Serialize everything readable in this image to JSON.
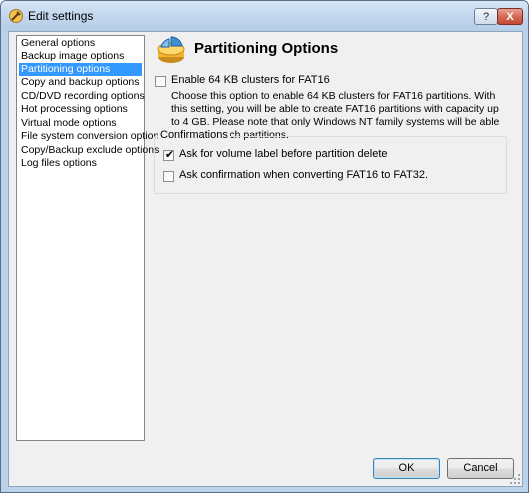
{
  "window": {
    "title": "Edit settings",
    "help_label": "?",
    "close_label": "X"
  },
  "nav": {
    "items": [
      {
        "label": "General options"
      },
      {
        "label": "Backup image options"
      },
      {
        "label": "Partitioning options"
      },
      {
        "label": "Copy and backup options"
      },
      {
        "label": "CD/DVD recording options"
      },
      {
        "label": "Hot processing options"
      },
      {
        "label": "Virtual mode options"
      },
      {
        "label": "File system conversion options"
      },
      {
        "label": "Copy/Backup exclude options"
      },
      {
        "label": "Log files options"
      }
    ],
    "selected": "Partitioning options"
  },
  "page": {
    "title": "Partitioning Options",
    "fat16_option": {
      "label": "Enable 64 KB clusters for FAT16",
      "checked": false,
      "description": "Choose this option to enable 64 KB clusters for FAT16 partitions. With this setting, you will be able to create FAT16 partitions with capacity up to 4 GB. Please note that only Windows NT family systems will be able to access such partitions."
    },
    "confirmations": {
      "legend": "Confirmations",
      "items": [
        {
          "label": "Ask for volume label before partition delete",
          "checked": true
        },
        {
          "label": "Ask confirmation when converting FAT16 to FAT32.",
          "checked": false
        }
      ]
    }
  },
  "buttons": {
    "ok": "OK",
    "cancel": "Cancel"
  },
  "icons": {
    "title": "settings-wrench-icon",
    "header": "partitioning-disk-icon"
  }
}
